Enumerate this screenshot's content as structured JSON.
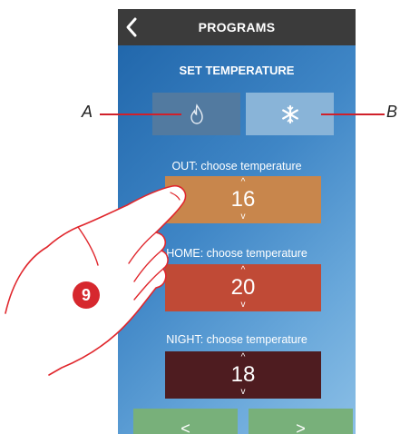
{
  "header": {
    "title": "PROGRAMS"
  },
  "set_temperature": {
    "heading": "SET TEMPERATURE"
  },
  "modes": {
    "heat_icon": "flame-icon",
    "cool_icon": "snowflake-icon"
  },
  "zones": [
    {
      "label": "OUT: choose temperature",
      "value": "16",
      "color": "#c8864c"
    },
    {
      "label": "HOME: choose temperature",
      "value": "20",
      "color": "#c04a36"
    },
    {
      "label": "NIGHT: choose temperature",
      "value": "18",
      "color": "#4e1c20"
    }
  ],
  "stepper": {
    "up": "^",
    "down": "v"
  },
  "nav": {
    "prev": "<",
    "next": ">"
  },
  "callouts": {
    "a": "A",
    "b": "B",
    "step": "9"
  }
}
